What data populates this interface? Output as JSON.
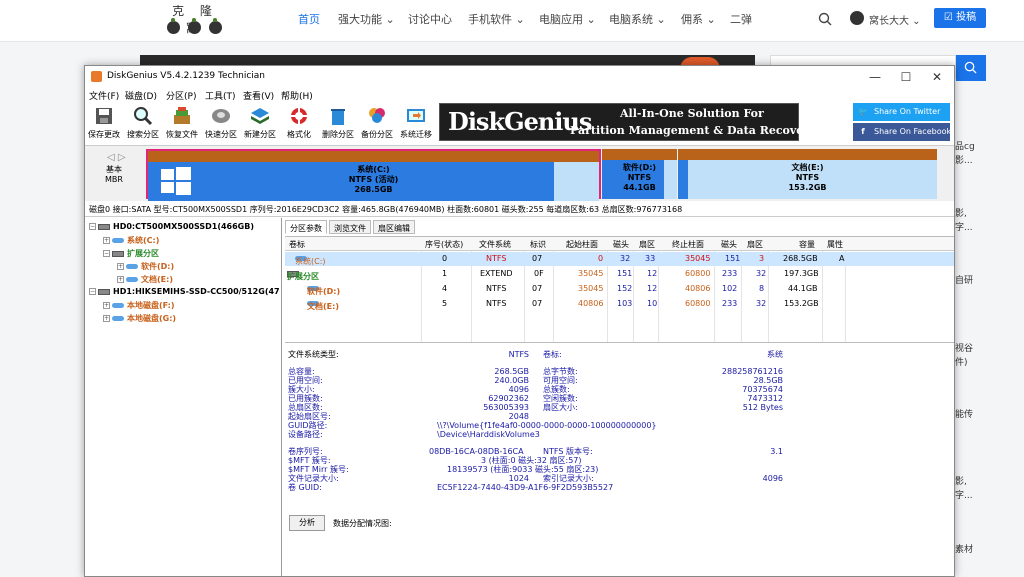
{
  "site": {
    "logo_text": "克 隆 窝",
    "nav": [
      {
        "label": "首页",
        "active": true
      },
      {
        "label": "强大功能 ⌄"
      },
      {
        "label": "讨论中心"
      },
      {
        "label": "手机软件 ⌄"
      },
      {
        "label": "电脑应用 ⌄"
      },
      {
        "label": "电脑系统 ⌄"
      },
      {
        "label": "佣系 ⌄"
      },
      {
        "label": "二弹"
      }
    ],
    "user_name": "窝长大大 ⌄",
    "post_button": "☑ 投稿",
    "sidebar_snippets": [
      "品cg",
      "影...",
      "影,",
      "字...",
      "自研",
      "视谷",
      "件)",
      "能传",
      "影,",
      "字...",
      "素材"
    ]
  },
  "window": {
    "title": "DiskGenius V5.4.2.1239 Technician",
    "controls": [
      "—",
      "☐",
      "✕"
    ],
    "menu": [
      "文件(F)",
      "磁盘(D)",
      "分区(P)",
      "工具(T)",
      "查看(V)",
      "帮助(H)"
    ],
    "toolbar": [
      "保存更改",
      "搜索分区",
      "恢复文件",
      "快速分区",
      "新建分区",
      "格式化",
      "删除分区",
      "备份分区",
      "系统迁移"
    ],
    "banner": {
      "logo": "DiskGenius",
      "line1": "All-In-One Solution For",
      "line2": "Partition Management & Data Recovery"
    },
    "share": {
      "twitter": "Share On Twitter",
      "facebook": "Share On Facebook"
    }
  },
  "diskmap": {
    "nav_arrows": "◁ ▷",
    "disk_type": "基本",
    "disk_style": "MBR",
    "partitions": [
      {
        "name": "系统(C:)",
        "fs": "NTFS (活动)",
        "size": "268.5GB",
        "used_fraction": 0.9
      },
      {
        "name": "软件(D:)",
        "fs": "NTFS",
        "size": "44.1GB",
        "used_fraction": 0.82
      },
      {
        "name": "文档(E:)",
        "fs": "NTFS",
        "size": "153.2GB",
        "used_fraction": 0.04
      }
    ],
    "info": "磁盘0 接口:SATA  型号:CT500MX500SSD1  序列号:2016E29CD3C2  容量:465.8GB(476940MB)  柱面数:60801  磁头数:255  每道扇区数:63  总扇区数:976773168"
  },
  "tree": [
    {
      "label": "HD0:CT500MX500SSD1(466GB)",
      "type": "disk",
      "level": 0
    },
    {
      "label": "系统(C:)",
      "type": "sys",
      "level": 1
    },
    {
      "label": "扩展分区",
      "type": "ext",
      "level": 1
    },
    {
      "label": "软件(D:)",
      "type": "log",
      "level": 2
    },
    {
      "label": "文档(E:)",
      "type": "log",
      "level": 2
    },
    {
      "label": "HD1:HIKSEMIHS-SSD-CC500/512G(47",
      "type": "disk",
      "level": 0
    },
    {
      "label": "本地磁盘(F:)",
      "type": "log",
      "level": 1
    },
    {
      "label": "本地磁盘(G:)",
      "type": "log",
      "level": 1
    }
  ],
  "tabs": [
    "分区参数",
    "浏览文件",
    "扇区编辑"
  ],
  "partition_table": {
    "headers": [
      "卷标",
      "序号(状态)",
      "文件系统",
      "标识",
      "起始柱面",
      "磁头",
      "扇区",
      "终止柱面",
      "磁头",
      "扇区",
      "容量",
      "属性"
    ],
    "rows": [
      [
        "系统(C:)",
        "0",
        "NTFS",
        "07",
        "0",
        "32",
        "33",
        "35045",
        "151",
        "3",
        "268.5GB",
        "A"
      ],
      [
        "扩展分区",
        "1",
        "EXTEND",
        "0F",
        "35045",
        "151",
        "12",
        "60800",
        "233",
        "32",
        "197.3GB",
        ""
      ],
      [
        "软件(D:)",
        "4",
        "NTFS",
        "07",
        "35045",
        "152",
        "12",
        "40806",
        "102",
        "8",
        "44.1GB",
        ""
      ],
      [
        "文档(E:)",
        "5",
        "NTFS",
        "07",
        "40806",
        "103",
        "10",
        "60800",
        "233",
        "32",
        "153.2GB",
        ""
      ]
    ]
  },
  "details": {
    "fs_type_label": "文件系统类型:",
    "fs_type": "NTFS",
    "vol_label_label": "卷标:",
    "vol_label": "系统",
    "left": [
      [
        "总容量:",
        "268.5GB"
      ],
      [
        "已用空间:",
        "240.0GB"
      ],
      [
        "簇大小:",
        "4096"
      ],
      [
        "已用簇数:",
        "62902362"
      ],
      [
        "总扇区数:",
        "563005393"
      ],
      [
        "起始扇区号:",
        "2048"
      ]
    ],
    "right": [
      [
        "总字节数:",
        "288258761216"
      ],
      [
        "可用空间:",
        "28.5GB"
      ],
      [
        "总簇数:",
        "70375674"
      ],
      [
        "空闲簇数:",
        "7473312"
      ],
      [
        "扇区大小:",
        "512 Bytes"
      ]
    ],
    "guid_path_label": "GUID路径:",
    "guid_path": "\\\\?\\Volume{f1fe4af0-0000-0000-0000-100000000000}",
    "device_path_label": "设备路径:",
    "device_path": "\\Device\\HarddiskVolume3",
    "serial_label": "卷序列号:",
    "serial": "08DB-16CA-08DB-16CA",
    "ntfs_ver_label": "NTFS 版本号:",
    "ntfs_ver": "3.1",
    "mft_label": "$MFT 簇号:",
    "mft": "3 (柱面:0 磁头:32 扇区:57)",
    "mftmirr_label": "$MFT Mirr 簇号:",
    "mftmirr": "18139573 (柱面:9033 磁头:55 扇区:23)",
    "frs_label": "文件记录大小:",
    "frs": "1024",
    "idx_label": "索引记录大小:",
    "idx": "4096",
    "vguid_label": "卷 GUID:",
    "vguid": "EC5F1224-7440-43D9-A1F6-9F2D593B5527",
    "analyze_button": "分析",
    "dist_label": "数据分配情况图:"
  }
}
